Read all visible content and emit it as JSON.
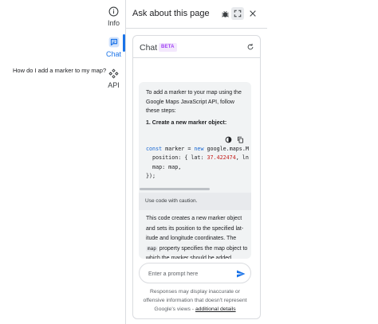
{
  "rail": {
    "items": [
      {
        "label": "Info",
        "icon": "info-icon"
      },
      {
        "label": "Chat",
        "icon": "chat-icon",
        "active": true
      },
      {
        "label": "API",
        "icon": "api-icon"
      }
    ]
  },
  "header": {
    "title": "Ask about this page",
    "buttons": [
      "bug-icon",
      "fullscreen-icon",
      "close-icon"
    ]
  },
  "chat": {
    "title": "Chat",
    "badge": "BETA",
    "user_question": "How do I add a marker to my map?",
    "answer_intro": "To add a marker to your map using the Google Maps JavaScript API, follow these steps:",
    "step_1": "1. Create a new marker object:",
    "code": {
      "line1_kw": "const",
      "line1_rest": " marker = ",
      "line1_kw2": "new",
      "line1_tail": " google.maps.M",
      "line2_a": "  position: { lat: ",
      "line2_num": "37.422474",
      "line2_b": ", ln",
      "line3": "  map: map,",
      "line4": "});"
    },
    "caution": "Use code with caution.",
    "answer_p2_a": "This code creates a new marker object and sets its position to the specified lat-itude and longitude coordinates. The ",
    "answer_p2_code": "map",
    "answer_p2_b": " property specifies the map object to which the marker should be added.",
    "prompt_placeholder": "Enter a prompt here",
    "disclaimer_text": "Responses may display inaccurate or offensive information that doesn't represent Google's views - ",
    "disclaimer_link": "additional details"
  },
  "colors": {
    "accent": "#1a73e8",
    "beta": "#a142f4",
    "answer_bg": "#f1f3f4"
  }
}
